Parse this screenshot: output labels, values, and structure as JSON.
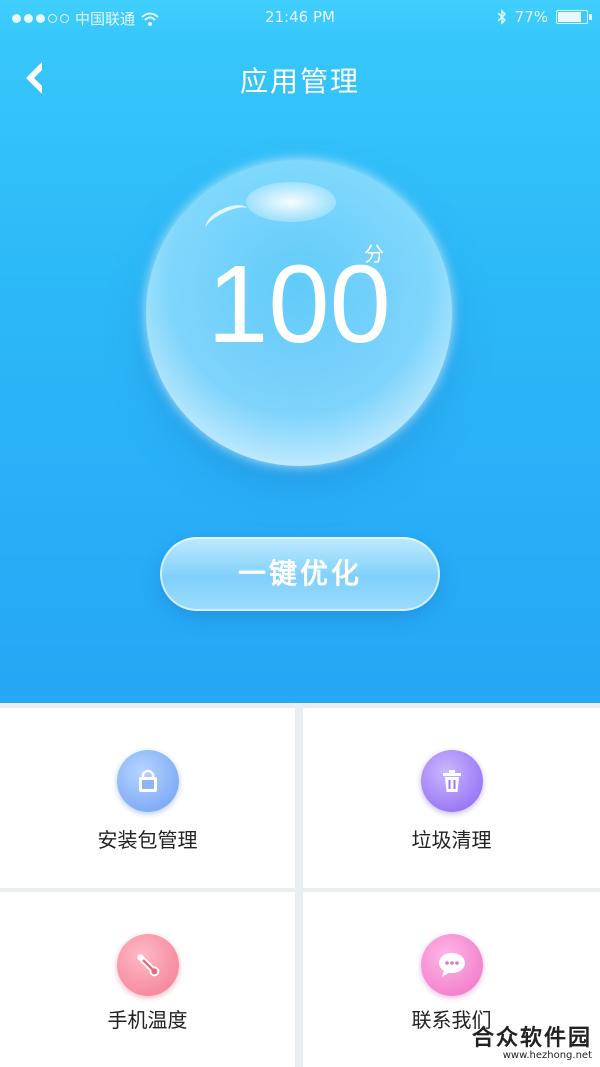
{
  "status_bar": {
    "carrier": "中国联通",
    "time": "21:46 PM",
    "battery": "77%",
    "battery_level": 0.77
  },
  "header": {
    "title": "应用管理"
  },
  "score": {
    "value": "100",
    "unit": "分"
  },
  "optimize_button": {
    "label": "一键优化"
  },
  "grid": {
    "items": [
      {
        "label": "安装包管理",
        "icon": "shopping-bag-icon",
        "color": "#7fa8f4"
      },
      {
        "label": "垃圾清理",
        "icon": "trash-icon",
        "color": "#9271f1"
      },
      {
        "label": "手机温度",
        "icon": "thermometer-icon",
        "color": "#f2899c"
      },
      {
        "label": "联系我们",
        "icon": "chat-bubble-icon",
        "color": "#f07fcc"
      }
    ]
  },
  "watermark": {
    "title": "合众软件园",
    "url": "www.hezhong.net"
  },
  "colors": {
    "header_gradient_top": "#39c9fb",
    "header_gradient_bottom": "#26a6f5"
  }
}
